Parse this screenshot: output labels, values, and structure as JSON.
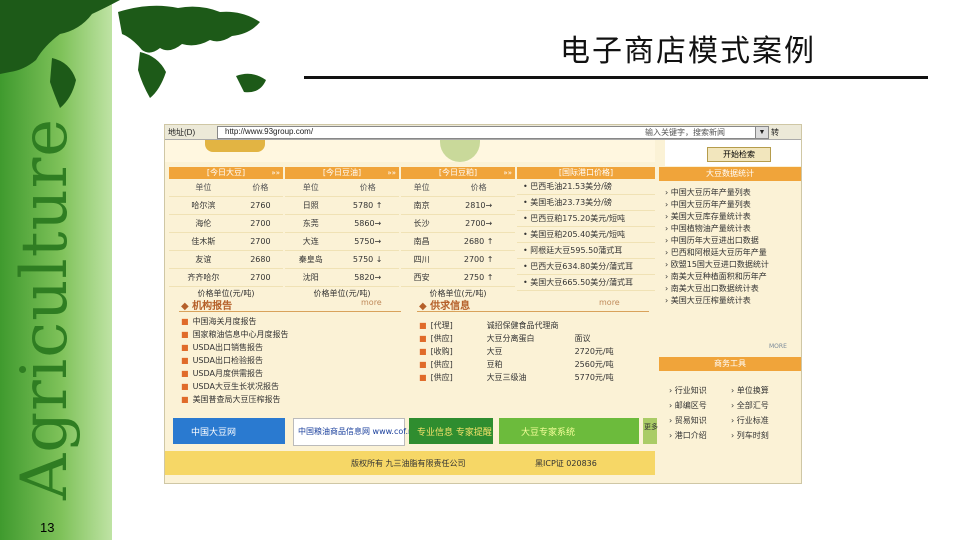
{
  "slide": {
    "title": "电子商店模式案例",
    "vertical_title": "Agriculture",
    "page_number": "13"
  },
  "colors": {
    "accent_orange": "#f0a43a",
    "band_green": "#3f9a2e",
    "page_cream": "#fbf2d6"
  },
  "screenshot": {
    "address_label": "地址(D)",
    "url": "http://www.93group.com/",
    "search_placeholder": "输入关键字，搜索新闻",
    "go_label": "转",
    "start_search_button": "开始检索",
    "price_tables": [
      {
        "title": "[今日大豆]",
        "headers": [
          "单位",
          "价格"
        ],
        "rows": [
          [
            "哈尔滨",
            "2760"
          ],
          [
            "海伦",
            "2700"
          ],
          [
            "佳木斯",
            "2700"
          ],
          [
            "友谊",
            "2680"
          ],
          [
            "齐齐哈尔",
            "2700"
          ]
        ],
        "footer": "价格单位(元/吨)"
      },
      {
        "title": "[今日豆油]",
        "headers": [
          "单位",
          "价格"
        ],
        "rows": [
          [
            "日照",
            "5780 ↑"
          ],
          [
            "东莞",
            "5860→"
          ],
          [
            "大连",
            "5750→"
          ],
          [
            "秦皇岛",
            "5750 ↓"
          ],
          [
            "沈阳",
            "5820→"
          ]
        ],
        "footer": "价格单位(元/吨)"
      },
      {
        "title": "[今日豆粕]",
        "headers": [
          "单位",
          "价格"
        ],
        "rows": [
          [
            "南京",
            "2810→"
          ],
          [
            "长沙",
            "2700→"
          ],
          [
            "南昌",
            "2680 ↑"
          ],
          [
            "四川",
            "2700 ↑"
          ],
          [
            "西安",
            "2750 ↑"
          ]
        ],
        "footer": "价格单位(元/吨)"
      }
    ],
    "import_prices": {
      "title": "[国际港口价格]",
      "items": [
        "巴西毛油21.53美分/磅",
        "美国毛油23.73美分/磅",
        "巴西豆粕175.20美元/短吨",
        "美国豆粕205.40美元/短吨",
        "阿根廷大豆595.50蒲式耳",
        "巴西大豆634.80美分/蒲式耳",
        "美国大豆665.50美分/蒲式耳"
      ]
    },
    "org_reports": {
      "title": "机构报告",
      "more": "more",
      "items": [
        "中国海关月度报告",
        "国家粮油信息中心月度报告",
        "USDA出口销售报告",
        "USDA出口检验报告",
        "USDA月度供需报告",
        "USDA大豆生长状况报告",
        "美国普查局大豆压榨报告"
      ]
    },
    "supply_info": {
      "title": "供求信息",
      "more": "more",
      "items": [
        {
          "type": "[代理]",
          "name": "诚招保健食品代理商",
          "price": ""
        },
        {
          "type": "[供应]",
          "name": "大豆分离蛋白",
          "price": "面议"
        },
        {
          "type": "[收购]",
          "name": "大豆",
          "price": "2720元/吨"
        },
        {
          "type": "[供应]",
          "name": "豆粕",
          "price": "2560元/吨"
        },
        {
          "type": "[供应]",
          "name": "大豆三级油",
          "price": "5770元/吨"
        }
      ]
    },
    "ads": [
      "中国大豆网",
      "中国粮油商品信息网 www.cof.net.cn",
      "专业信息 专家提醒",
      "大豆专家系统",
      "更多"
    ],
    "footer": {
      "copyright": "版权所有 九三油脂有限责任公司",
      "icp": "黑ICP证 020836"
    },
    "stats": {
      "title": "大豆数据统计",
      "items": [
        "中国大豆历年产量列表",
        "中国大豆历年产量列表",
        "美国大豆库存量统计表",
        "中国植物油产量统计表",
        "中国历年大豆进出口数据",
        "巴西和阿根廷大豆历年产量",
        "欧盟15国大豆进口数据统计",
        "南美大豆种植面积和历年产",
        "南美大豆出口数据统计表",
        "美国大豆压榨量统计表"
      ],
      "more": "MORE"
    },
    "tools": {
      "title": "商务工具",
      "items": [
        [
          "行业知识",
          "单位换算"
        ],
        [
          "邮编区号",
          "全部汇号"
        ],
        [
          "贸易知识",
          "行业标准"
        ],
        [
          "港口介绍",
          "列车时刻"
        ]
      ]
    }
  }
}
